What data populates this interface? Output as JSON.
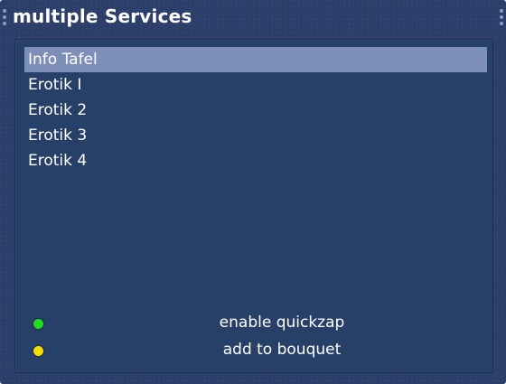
{
  "window": {
    "title": "multiple Services"
  },
  "services": [
    {
      "label": "Info Tafel",
      "selected": true
    },
    {
      "label": "Erotik I",
      "selected": false
    },
    {
      "label": "Erotik 2",
      "selected": false
    },
    {
      "label": "Erotik 3",
      "selected": false
    },
    {
      "label": "Erotik 4",
      "selected": false
    }
  ],
  "legend": [
    {
      "icon": "green-button-icon",
      "color": "#22dd22",
      "label": "enable quickzap"
    },
    {
      "icon": "yellow-button-icon",
      "color": "#f2e000",
      "label": "add to bouquet"
    }
  ],
  "colors": {
    "background": "#2c3f6a",
    "panel": "#264068",
    "selection": "#7d8fb6",
    "text": "#ffffff"
  }
}
